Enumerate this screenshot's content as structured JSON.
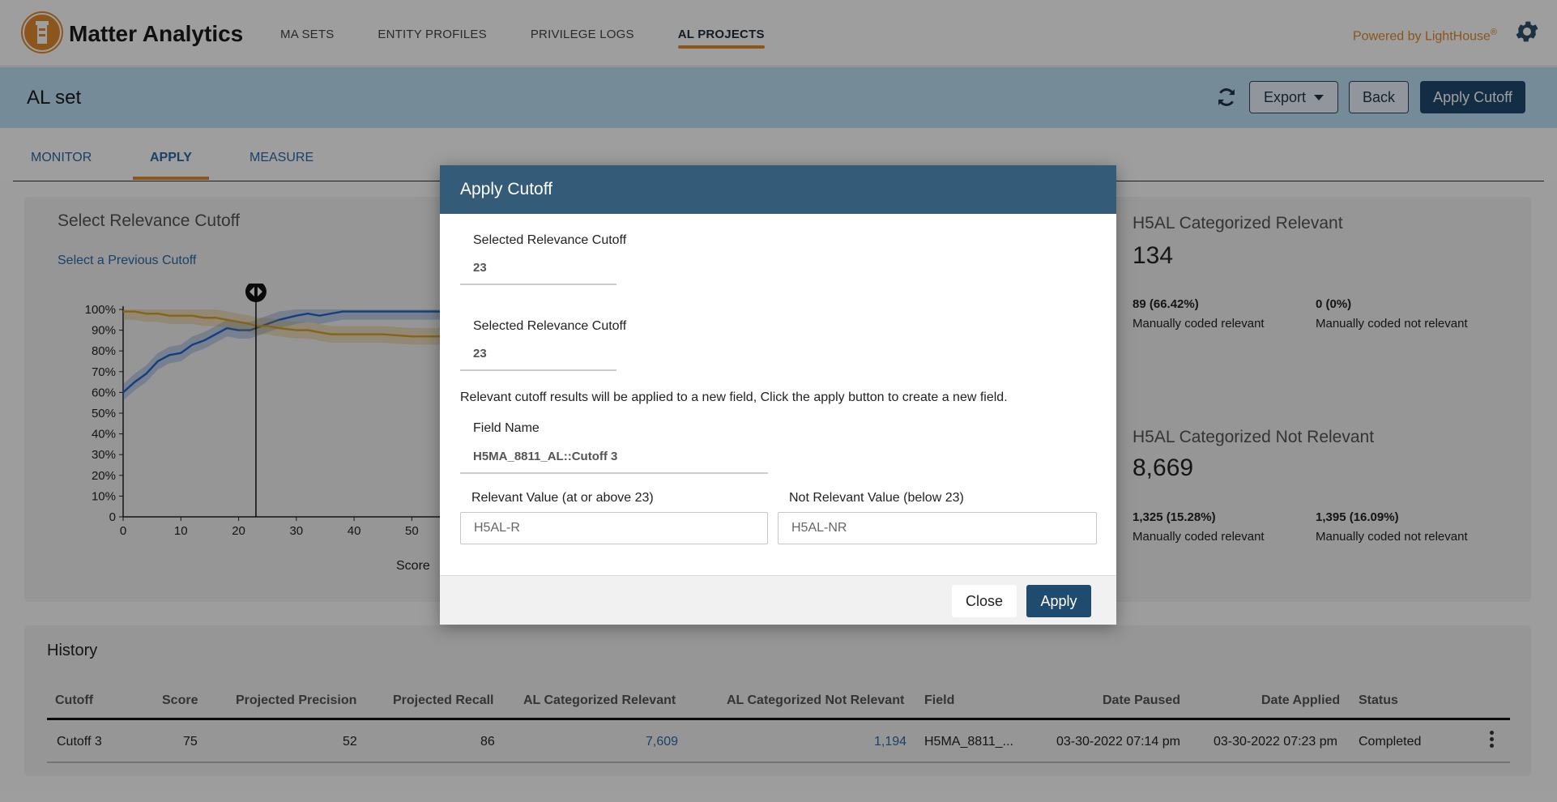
{
  "app": {
    "brand": "Matter Analytics",
    "powered_by": "Powered by LightHouse",
    "powered_mark": "®"
  },
  "nav": {
    "items": [
      {
        "label": "MA SETS"
      },
      {
        "label": "ENTITY PROFILES"
      },
      {
        "label": "PRIVILEGE LOGS"
      },
      {
        "label": "AL PROJECTS",
        "active": true
      }
    ]
  },
  "subheader": {
    "title": "AL set",
    "export_label": "Export",
    "back_label": "Back",
    "apply_cutoff_label": "Apply Cutoff"
  },
  "tabs": [
    {
      "label": "MONITOR"
    },
    {
      "label": "APPLY",
      "active": true
    },
    {
      "label": "MEASURE"
    }
  ],
  "cutoff_panel": {
    "title": "Select Relevance Cutoff",
    "previous_link": "Select a Previous Cutoff",
    "xlabel": "Score"
  },
  "chart_data": {
    "type": "line",
    "xlabel": "Score",
    "ylabel": "",
    "x_ticks": [
      "0",
      "10",
      "20",
      "30",
      "40",
      "50"
    ],
    "y_ticks": [
      "0",
      "10%",
      "20%",
      "30%",
      "40%",
      "50%",
      "60%",
      "70%",
      "80%",
      "90%",
      "100%"
    ],
    "xlim": [
      0,
      55
    ],
    "ylim": [
      0,
      100
    ],
    "cutoff_marker": 23,
    "series": [
      {
        "color": "#2366c9",
        "x": [
          0,
          2,
          4,
          6,
          8,
          10,
          12,
          14,
          16,
          18,
          20,
          22,
          23,
          25,
          27,
          30,
          32,
          34,
          36,
          38,
          40,
          45,
          50,
          55
        ],
        "y": [
          60,
          65,
          69,
          75,
          78,
          79,
          83,
          85,
          88,
          91,
          90,
          90,
          91,
          93,
          95,
          97,
          98,
          97,
          98,
          99,
          99,
          99,
          99,
          99
        ]
      },
      {
        "color": "#d9a024",
        "x": [
          0,
          2,
          4,
          6,
          8,
          10,
          12,
          14,
          16,
          18,
          20,
          22,
          23,
          25,
          27,
          30,
          32,
          34,
          36,
          38,
          40,
          45,
          50,
          55
        ],
        "y": [
          99,
          99,
          98,
          98,
          97,
          97,
          97,
          96,
          96,
          95,
          94,
          93,
          92,
          92,
          91,
          90,
          90,
          89,
          88,
          88,
          88,
          88,
          87,
          87
        ]
      }
    ]
  },
  "stats": {
    "relevant": {
      "title": "H5AL Categorized Relevant",
      "count": "134",
      "a_value": "89 (66.42%)",
      "a_label": "Manually coded relevant",
      "b_value": "0 (0%)",
      "b_label": "Manually coded not relevant"
    },
    "not_relevant": {
      "title": "H5AL Categorized Not Relevant",
      "count": "8,669",
      "a_value": "1,325 (15.28%)",
      "a_label": "Manually coded relevant",
      "b_value": "1,395 (16.09%)",
      "b_label": "Manually coded not relevant"
    }
  },
  "history": {
    "title": "History",
    "columns": [
      "Cutoff",
      "Score",
      "Projected Precision",
      "Projected Recall",
      "AL Categorized Relevant",
      "AL Categorized Not Relevant",
      "Field",
      "Date Paused",
      "Date Applied",
      "Status"
    ],
    "rows": [
      [
        "Cutoff 3",
        "75",
        "52",
        "86",
        "7,609",
        "1,194",
        "H5MA_8811_...",
        "03-30-2022 07:14 pm",
        "03-30-2022 07:23 pm",
        "Completed"
      ]
    ]
  },
  "modal": {
    "title": "Apply Cutoff",
    "field1_label": "Selected Relevance Cutoff",
    "field1_value": "23",
    "field2_label": "Selected Relevance Cutoff",
    "field2_value": "23",
    "info_text": "Relevant cutoff results will be applied to a new field, Click the apply button to create a new field.",
    "field_name_label": "Field Name",
    "field_name_value": "H5MA_8811_AL::Cutoff 3",
    "relevant_value_label": "Relevant Value (at or above 23)",
    "relevant_value_placeholder": "H5AL-R",
    "not_relevant_value_label": "Not Relevant Value (below 23)",
    "not_relevant_value_placeholder": "H5AL-NR",
    "close_label": "Close",
    "apply_label": "Apply"
  },
  "colors": {
    "accent_orange": "#e08a2c",
    "navy": "#1f4b6e",
    "modal_header": "#345b78",
    "link_blue": "#2a6aa7"
  }
}
